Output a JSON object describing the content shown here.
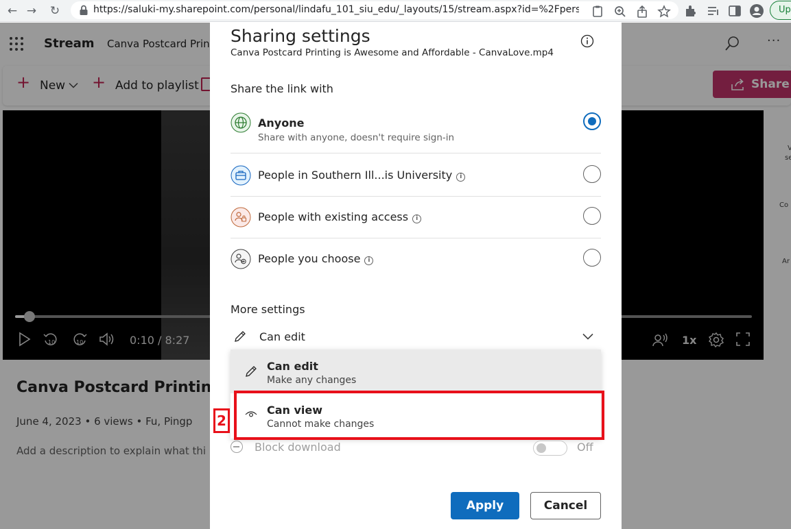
{
  "browser": {
    "url": "https://saluki-my.sharepoint.com/personal/lindafu_101_siu_edu/_layouts/15/stream.aspx?id=%2Fpersonal...",
    "update_label": "Up"
  },
  "app": {
    "name": "Stream",
    "doc_title": "Canva Postcard Prin",
    "toolbar": {
      "new_label": "New",
      "add_playlist_label": "Add to playlist",
      "share_label": "Share"
    },
    "player": {
      "progress_fraction": 0.02,
      "time": "0:10 / 8:27",
      "speed": "1x"
    },
    "right_rail": [
      "V",
      "se",
      "Co",
      "Ar"
    ],
    "video_title": "Canva Postcard Printing i",
    "meta": "June 4, 2023  •  6 views  •  Fu, Pingp",
    "description": "Add a description to explain what thi"
  },
  "dialog": {
    "title": "Sharing settings",
    "subtitle": "Canva Postcard Printing is Awesome and Affordable - CanvaLove.mp4",
    "share_link_with": "Share the link with",
    "options": [
      {
        "label": "Anyone",
        "desc": "Share with anyone, doesn't require sign-in",
        "checked": true,
        "icon": "globe-icon"
      },
      {
        "label": "People in Southern Ill...is University",
        "desc": "",
        "checked": false,
        "icon": "briefcase-icon"
      },
      {
        "label": "People with existing access",
        "desc": "",
        "checked": false,
        "icon": "people-lock-icon"
      },
      {
        "label": "People you choose",
        "desc": "",
        "checked": false,
        "icon": "people-add-icon"
      }
    ],
    "more_settings": "More settings",
    "permission": {
      "selected": "Can edit",
      "items": [
        {
          "label": "Can edit",
          "desc": "Make any changes"
        },
        {
          "label": "Can view",
          "desc": "Cannot make changes"
        }
      ]
    },
    "block_download": {
      "label": "Block download",
      "state": "Off"
    },
    "apply_label": "Apply",
    "cancel_label": "Cancel",
    "info_glyph": "i"
  },
  "annotation": {
    "badge": "2",
    "color": "#e8101a"
  },
  "colors": {
    "accent": "#0f6cbd",
    "brand": "#c0336a"
  }
}
